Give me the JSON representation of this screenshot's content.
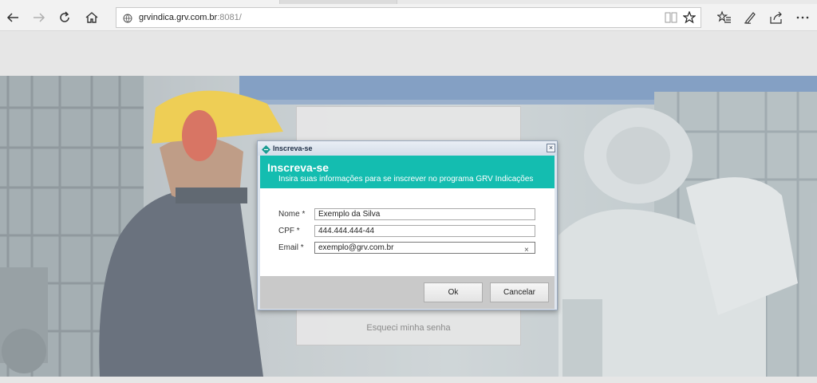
{
  "browser": {
    "url_host": "grvindica.grv.com.br",
    "url_port": ":8081/",
    "icons": [
      "back-icon",
      "forward-icon",
      "refresh-icon",
      "home-icon",
      "globe-icon",
      "reading-view-icon",
      "favorite-star-icon",
      "favorites-hub-icon",
      "web-note-icon",
      "share-icon",
      "more-icon"
    ]
  },
  "login_panel": {
    "forgot_password": "Esqueci minha senha"
  },
  "dialog": {
    "window_title": "Inscreva-se",
    "close_glyph": "×",
    "header_title": "Inscreva-se",
    "header_subtitle": "Insira suas informações para se inscrever no programa GRV Indicações",
    "fields": {
      "nome_label": "Nome *",
      "nome_value": "Exemplo da Silva",
      "cpf_label": "CPF *",
      "cpf_value": "444.444.444-44",
      "email_label": "Email *",
      "email_value": "exemplo@grv.com.br",
      "email_clear": "×"
    },
    "buttons": {
      "ok": "Ok",
      "cancel": "Cancelar"
    }
  },
  "colors": {
    "dialog_header": "#14bdb0",
    "dialog_footer": "#c9c9c9"
  }
}
